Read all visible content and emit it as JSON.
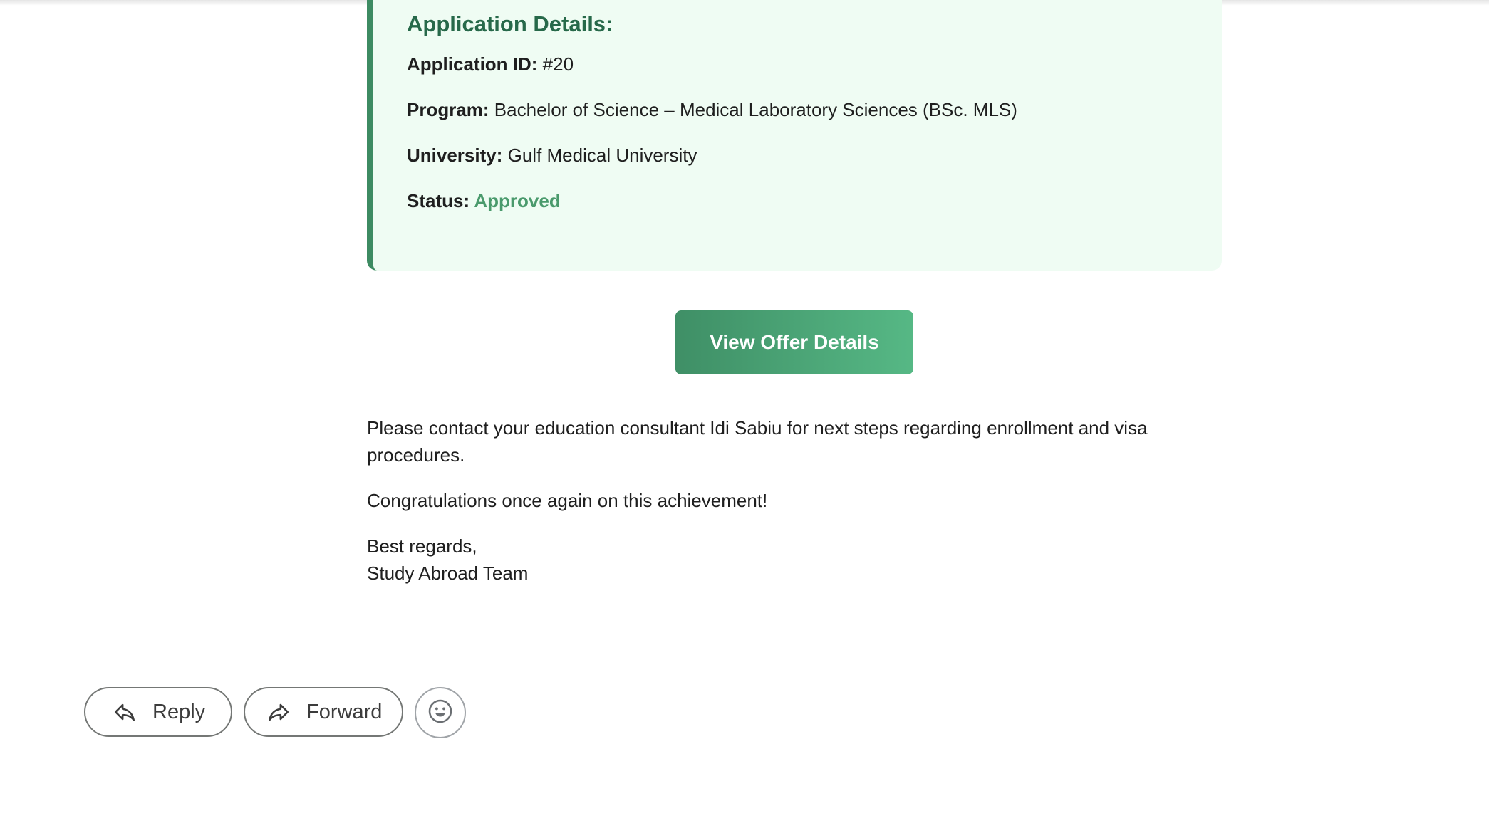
{
  "details": {
    "title": "Application Details:",
    "application_id_label": "Application ID:",
    "application_id_value": " #20",
    "program_label": "Program:",
    "program_value": " Bachelor of Science – Medical Laboratory Sciences (BSc. MLS)",
    "university_label": "University:",
    "university_value": " Gulf Medical University",
    "status_label": "Status:",
    "status_value": " Approved"
  },
  "offer_button_label": "View Offer Details",
  "body": {
    "paragraph1": "Please contact your education consultant Idi Sabiu for next steps regarding enrollment and visa procedures.",
    "paragraph2": "Congratulations once again on this achievement!",
    "signoff_line1": "Best regards,",
    "signoff_line2": "Study Abroad Team"
  },
  "actions": {
    "reply_label": "Reply",
    "forward_label": "Forward",
    "reply_icon": "reply-arrow-icon",
    "forward_icon": "forward-arrow-icon",
    "emoji_icon": "smiley-icon"
  },
  "colors": {
    "card_background": "#effcf3",
    "card_accent": "#3d8b62",
    "title_color": "#27694a",
    "status_approved": "#4a9a6c",
    "button_gradient_start": "#3f8f66",
    "button_gradient_end": "#56b885"
  }
}
